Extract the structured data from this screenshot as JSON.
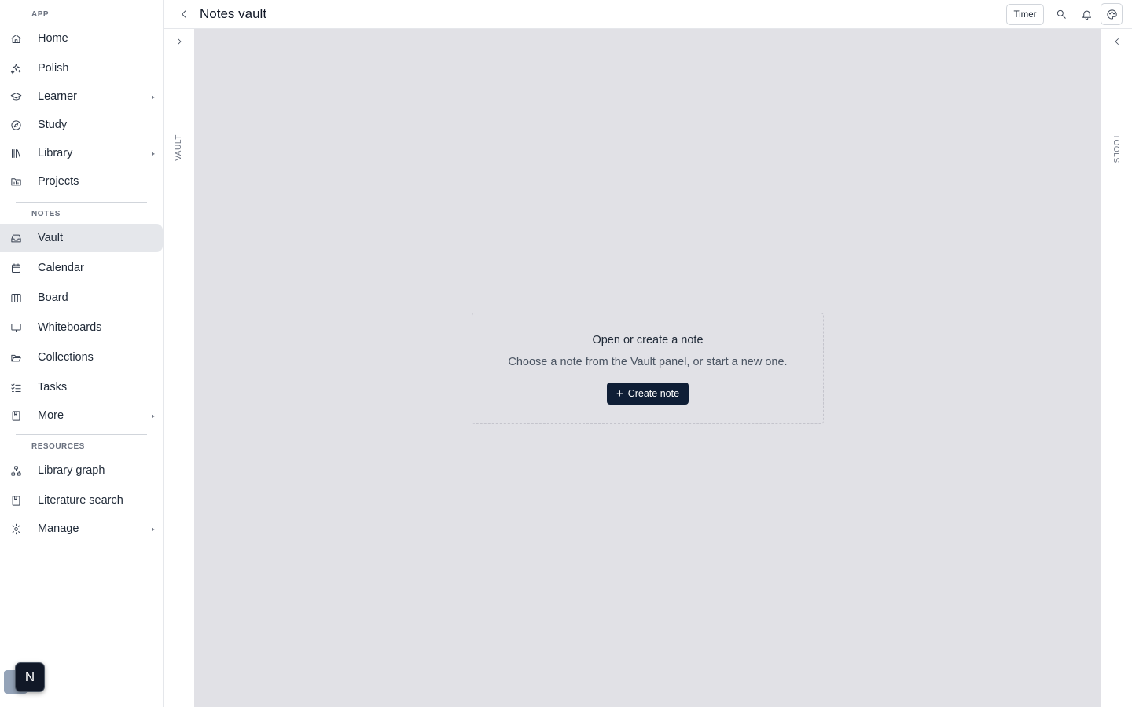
{
  "sidebar": {
    "sections": {
      "app": "APP",
      "notes": "NOTES",
      "resources": "RESOURCES"
    },
    "items": [
      {
        "label": "Home",
        "icon": "home-icon"
      },
      {
        "label": "Polish",
        "icon": "sparkles-icon"
      },
      {
        "label": "Learner",
        "icon": "graduation-cap-icon",
        "expandable": true
      },
      {
        "label": "Study",
        "icon": "compass-icon"
      },
      {
        "label": "Library",
        "icon": "library-icon",
        "expandable": true
      },
      {
        "label": "Projects",
        "icon": "folder-chart-icon"
      },
      {
        "label": "Vault",
        "icon": "inbox-icon",
        "active": true
      },
      {
        "label": "Calendar",
        "icon": "calendar-icon"
      },
      {
        "label": "Board",
        "icon": "columns-icon"
      },
      {
        "label": "Whiteboards",
        "icon": "presentation-icon"
      },
      {
        "label": "Collections",
        "icon": "folder-open-icon"
      },
      {
        "label": "Tasks",
        "icon": "list-checks-icon"
      },
      {
        "label": "More",
        "icon": "bookmark-book-icon",
        "expandable": true
      },
      {
        "label": "Library graph",
        "icon": "network-icon"
      },
      {
        "label": "Literature search",
        "icon": "book-search-icon"
      },
      {
        "label": "Manage",
        "icon": "gear-icon",
        "expandable": true
      }
    ],
    "badge": "N"
  },
  "header": {
    "title": "Notes vault",
    "timer_label": "Timer"
  },
  "rails": {
    "left_label": "VAULT",
    "right_label": "TOOLS"
  },
  "main": {
    "empty_title": "Open or create a note",
    "empty_subtitle": "Choose a note from the Vault panel, or start a new one.",
    "create_label": "Create note",
    "create_icon": "+"
  },
  "colors": {
    "canvas": "#e1e1e6",
    "primary_button": "#0f1e36",
    "active_item": "#e5e7eb"
  }
}
